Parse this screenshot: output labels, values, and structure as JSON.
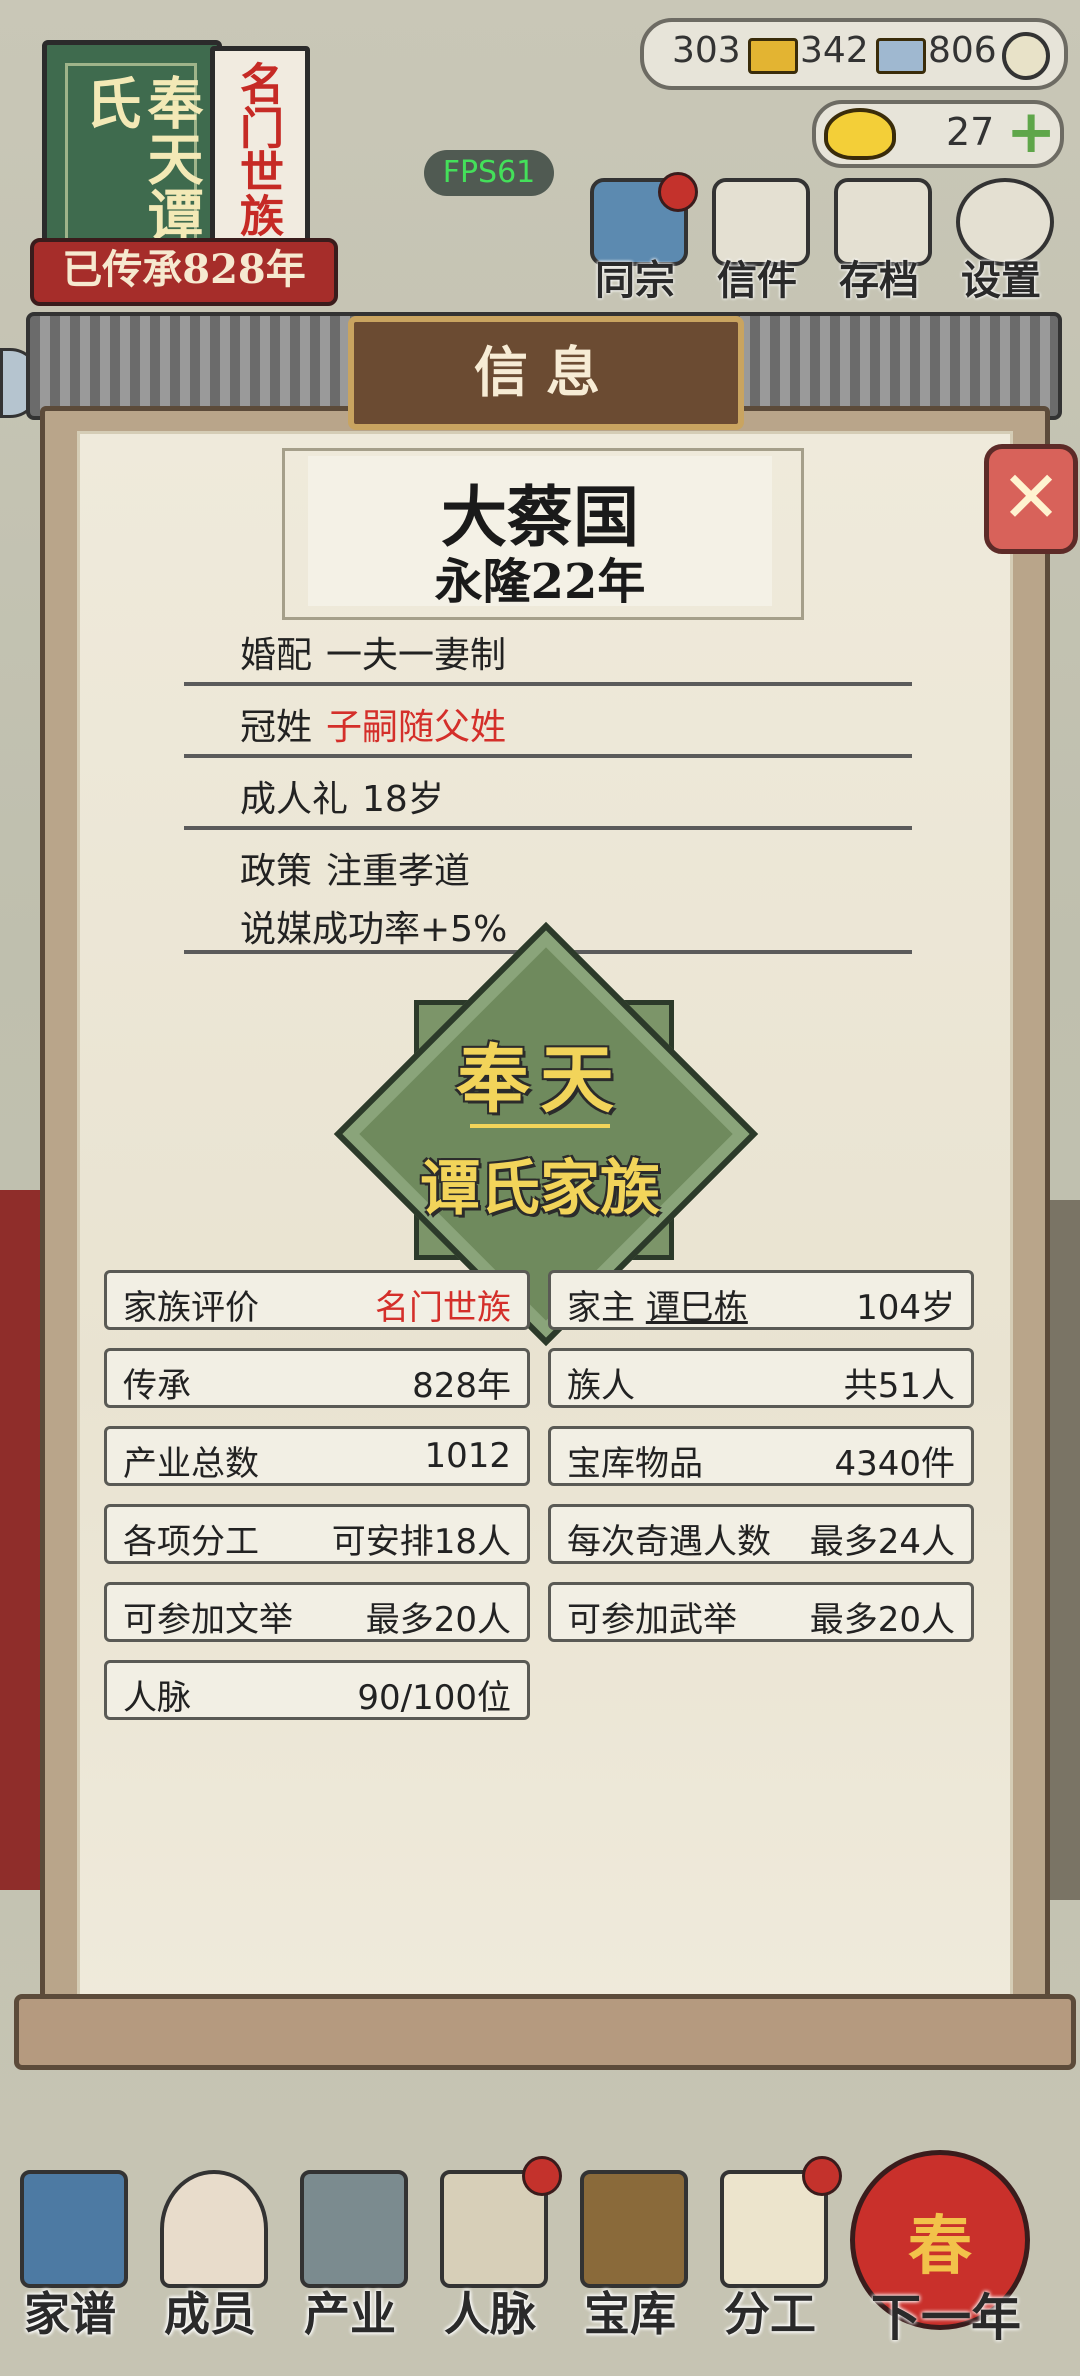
{
  "banner": {
    "book_title": "奉天谭氏",
    "tag_text": "名门世族",
    "inheritance_text": "已传承828年"
  },
  "currency": {
    "bronze_value": "303",
    "gold_bar_value": "342",
    "silver_bar_value": "806",
    "gold_ingot_value": "27"
  },
  "fps": "FPS61",
  "top_menu": [
    {
      "label": "同宗",
      "icon": "books-icon",
      "badge": true
    },
    {
      "label": "信件",
      "icon": "letter-icon",
      "badge": false
    },
    {
      "label": "存档",
      "icon": "brush-icon",
      "badge": false
    },
    {
      "label": "设置",
      "icon": "gear-icon",
      "badge": false
    }
  ],
  "dialog": {
    "title": "信息",
    "country": "大蔡国",
    "reign": "永隆22年",
    "policies": {
      "marriage_key": "婚配",
      "marriage_val": "一夫一妻制",
      "surname_key": "冠姓",
      "surname_val": "子嗣随父姓",
      "adult_key": "成人礼",
      "adult_val": "18岁",
      "policy_key": "政策",
      "policy_val": "注重孝道",
      "policy_effect": "说媒成功率+5%"
    },
    "emblem": {
      "line1": "奉天",
      "line2": "谭氏家族"
    },
    "stats": {
      "rating_key": "家族评价",
      "rating_val": "名门世族",
      "head_key": "家主",
      "head_name": "谭巳栋",
      "head_age": "104岁",
      "inherit_key": "传承",
      "inherit_val": "828年",
      "clan_key": "族人",
      "clan_val": "共51人",
      "estate_key": "产业总数",
      "estate_val": "1012",
      "treasury_key": "宝库物品",
      "treasury_val": "4340件",
      "labor_key": "各项分工",
      "labor_val": "可安排18人",
      "encounter_key": "每次奇遇人数",
      "encounter_val": "最多24人",
      "civil_key": "可参加文举",
      "civil_val": "最多20人",
      "military_key": "可参加武举",
      "military_val": "最多20人",
      "network_key": "人脉",
      "network_val": "90/100位"
    }
  },
  "bottom_nav": [
    {
      "label": "家谱"
    },
    {
      "label": "成员"
    },
    {
      "label": "产业"
    },
    {
      "label": "人脉"
    },
    {
      "label": "宝库"
    },
    {
      "label": "分工"
    }
  ],
  "next_year": {
    "lantern_text": "春",
    "label": "下一年"
  },
  "colors": {
    "accent_red": "#d42f2a",
    "emblem_green": "#6f8a5d",
    "plaque_brown": "#6b4b32"
  }
}
